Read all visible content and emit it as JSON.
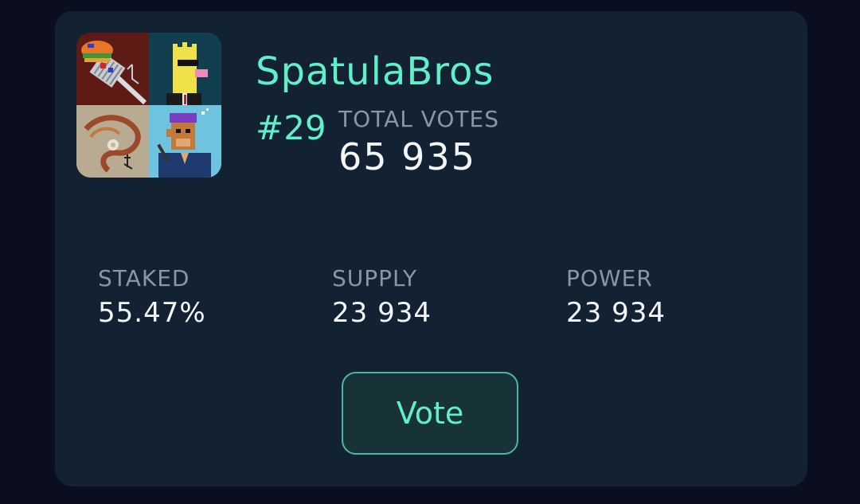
{
  "project": {
    "name": "SpatulaBros",
    "rank": "#29",
    "avatar_tiles": [
      "spatula-burger-icon",
      "pixel-duck-sunglasses-icon",
      "dragon-scroll-icon",
      "pixel-ninja-ape-icon"
    ]
  },
  "votes": {
    "label": "TOTAL VOTES",
    "value": "65 935"
  },
  "stats": [
    {
      "label": "STAKED",
      "value": "55.47%"
    },
    {
      "label": "SUPPLY",
      "value": "23 934"
    },
    {
      "label": "POWER",
      "value": "23 934"
    }
  ],
  "actions": {
    "vote_label": "Vote"
  },
  "colors": {
    "accent": "#5ff0c8",
    "card_bg": "#122232",
    "page_bg": "#0a0e1e",
    "muted_text": "#8a96a2",
    "value_text": "#f4f6f8"
  }
}
